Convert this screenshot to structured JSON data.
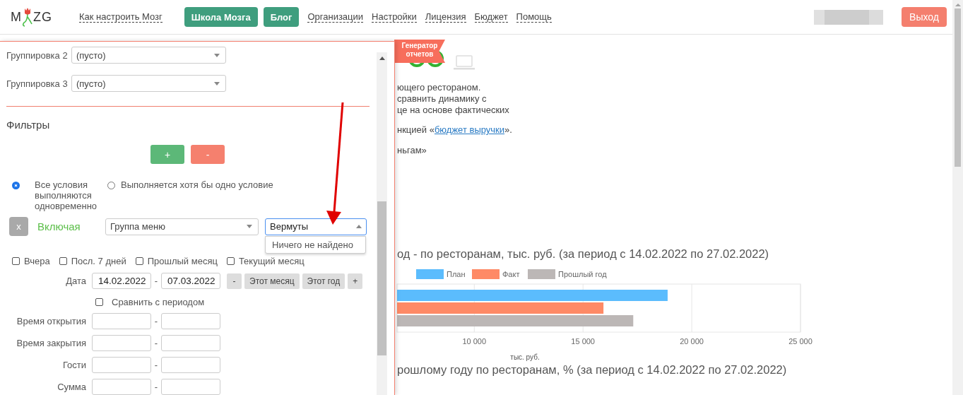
{
  "header": {
    "logo_left": "M",
    "logo_right": "ZG",
    "nav": [
      {
        "label": "Как настроить Мозг",
        "kind": "link"
      },
      {
        "label": "Школа Мозга",
        "kind": "button"
      },
      {
        "label": "Блог",
        "kind": "button"
      },
      {
        "label": "Организации",
        "kind": "link"
      },
      {
        "label": "Настройки",
        "kind": "link"
      },
      {
        "label": "Лицензия",
        "kind": "link"
      },
      {
        "label": "Бюджет",
        "kind": "link"
      },
      {
        "label": "Помощь",
        "kind": "link"
      }
    ],
    "logout": "Выход"
  },
  "report_badge": [
    "Генератор",
    "отчетов"
  ],
  "description": [
    {
      "text": "ющего рестораном."
    },
    {
      "text": "сравнить динамику с"
    },
    {
      "text": "це на основе фактических"
    },
    {
      "text": "нкцией «",
      "link": "бюджет выручки",
      "after": "»."
    },
    {
      "text": "ньгам»"
    }
  ],
  "charts": [
    {
      "title": "од - по ресторанам, тыс. руб. (за период с 14.02.2022 по 27.02.2022)",
      "chart_data": {
        "type": "bar",
        "orientation": "horizontal",
        "grid": true,
        "legend": true,
        "xlabel": "тыс. руб.",
        "xlim": [
          6450,
          25000
        ],
        "xticks": [
          {
            "value": 10000,
            "label": "10 000"
          },
          {
            "value": 15000,
            "label": "15 000"
          },
          {
            "value": 20000,
            "label": "20 000"
          },
          {
            "value": 25000,
            "label": "25 000"
          }
        ],
        "series": [
          {
            "name": "План",
            "color": "#5bbcfd",
            "values": [
              18890
            ]
          },
          {
            "name": "Факт",
            "color": "#fe8a66",
            "values": [
              15940
            ]
          },
          {
            "name": "Прошлый год",
            "color": "#bcb7b6",
            "values": [
              17310
            ]
          }
        ]
      }
    },
    {
      "title": "рошлому году по ресторанам, % (за период с 14.02.2022 по 27.02.2022)"
    }
  ],
  "panel": {
    "groupings": [
      {
        "label": "Группировка 2",
        "value": "(пусто)"
      },
      {
        "label": "Группировка 3",
        "value": "(пусто)"
      }
    ],
    "filters_title": "Фильтры",
    "add_button": "+",
    "remove_button": "-",
    "match_modes": [
      {
        "label": "Все условия выполняются одновременно",
        "selected": true
      },
      {
        "label": "Выполняется хотя бы одно условие",
        "selected": false
      }
    ],
    "conditions": [
      {
        "remove": "x",
        "mode": "Включая",
        "field": "Группа меню",
        "query": "Вермуты",
        "focused": true,
        "message": "Ничего не найдено"
      }
    ],
    "quick_periods": [
      {
        "label": "Вчера",
        "checked": false
      },
      {
        "label": "Посл. 7 дней",
        "checked": false
      },
      {
        "label": "Прошлый месяц",
        "checked": false
      },
      {
        "label": "Текущий месяц",
        "checked": false
      }
    ],
    "date": {
      "label": "Дата",
      "from": "14.02.2022",
      "to": "07.03.2022",
      "separator": "-",
      "buttons": [
        "-",
        "Этот месяц",
        "Этот год",
        "+"
      ]
    },
    "compare": {
      "label": "Сравнить с периодом",
      "checked": false
    },
    "ranges": [
      {
        "label": "Время открытия",
        "separator": "-"
      },
      {
        "label": "Время закрытия",
        "separator": "-"
      },
      {
        "label": "Гости",
        "separator": "-"
      },
      {
        "label": "Сумма",
        "separator": "-"
      }
    ]
  }
}
